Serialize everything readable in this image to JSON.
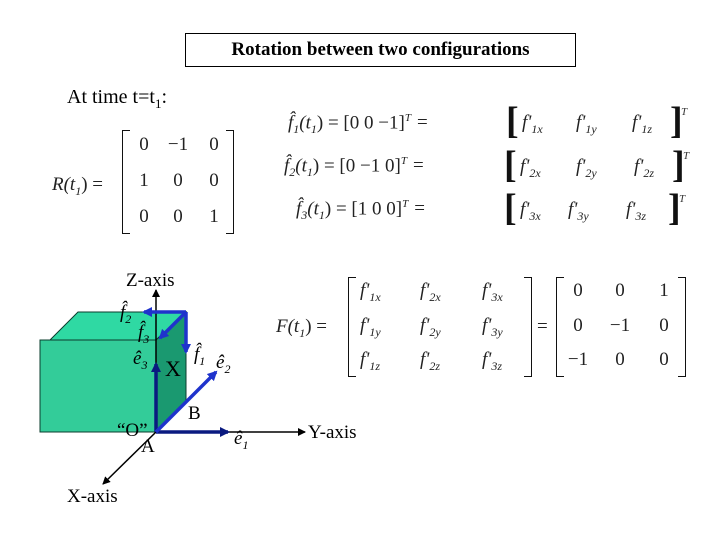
{
  "title": "Rotation between two configurations",
  "at_time": {
    "prefix": "At time t=t",
    "sub": "1",
    "suffix": ":"
  },
  "rotation_matrix": {
    "label": "R(t",
    "label_sub": "1",
    "label_end": ") =",
    "rows": [
      [
        "0",
        "−1",
        "0"
      ],
      [
        "1",
        "0",
        "0"
      ],
      [
        "0",
        "0",
        "1"
      ]
    ]
  },
  "f_vectors": [
    {
      "name": "f̂",
      "index": "1",
      "arg": "(t",
      "arg_sub": "1",
      "arg_end": ") = [0    0    −1]",
      "T": "T",
      "eq": "=",
      "components": [
        "f'",
        "f'",
        "f'"
      ],
      "subs": [
        "1x",
        "1y",
        "1z"
      ]
    },
    {
      "name": "f̂",
      "index": "2",
      "arg": "(t",
      "arg_sub": "1",
      "arg_end": ") = [0   −1    0]",
      "T": "T",
      "eq": "=",
      "components": [
        "f'",
        "f'",
        "f'"
      ],
      "subs": [
        "2x",
        "2y",
        "2z"
      ]
    },
    {
      "name": "f̂",
      "index": "3",
      "arg": "(t",
      "arg_sub": "1",
      "arg_end": ") = [1    0    0]",
      "T": "T",
      "eq": "=",
      "components": [
        "f'",
        "f'",
        "f'"
      ],
      "subs": [
        "3x",
        "3y",
        "3z"
      ]
    }
  ],
  "F_matrix": {
    "label": "F(t",
    "label_sub": "1",
    "label_end": ") =",
    "symbolic": [
      [
        "1x",
        "2x",
        "3x"
      ],
      [
        "1y",
        "2y",
        "3y"
      ],
      [
        "1z",
        "2z",
        "3z"
      ]
    ],
    "prime": "f'",
    "eq": "=",
    "numeric": [
      [
        "0",
        "0",
        "1"
      ],
      [
        "0",
        "−1",
        "0"
      ],
      [
        "−1",
        "0",
        "0"
      ]
    ]
  },
  "diagram": {
    "z_axis": "Z-axis",
    "y_axis": "Y-axis",
    "x_axis": "X-axis",
    "origin": "“O”",
    "point_a": "A",
    "point_b": "B",
    "cross": "X",
    "f2": "f̂",
    "f2_sub": "2",
    "f3": "f̂",
    "f3_sub": "3",
    "f1": "f̂",
    "f1_sub": "1",
    "e1": "ê",
    "e1_sub": "1",
    "e2": "ê",
    "e2_sub": "2",
    "e3": "ê",
    "e3_sub": "3",
    "colors": {
      "cube_front": "#33cc99",
      "cube_top": "#2fd9a3",
      "cube_side": "#1a9970",
      "vector_blue": "#1f33cc",
      "vector_dark": "#0a1a80"
    }
  }
}
